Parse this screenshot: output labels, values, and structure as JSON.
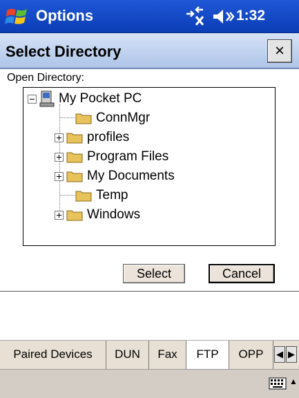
{
  "topbar": {
    "title": "Options",
    "time": "1:32"
  },
  "dialog": {
    "title": "Select Directory",
    "close_label": "×",
    "open_label": "Open Directory:",
    "tree": {
      "root": "My Pocket PC",
      "items": [
        {
          "label": "ConnMgr",
          "expandable": false
        },
        {
          "label": "profiles",
          "expandable": true
        },
        {
          "label": "Program Files",
          "expandable": true
        },
        {
          "label": "My Documents",
          "expandable": true
        },
        {
          "label": "Temp",
          "expandable": false
        },
        {
          "label": "Windows",
          "expandable": true
        }
      ]
    },
    "select_label": "Select",
    "cancel_label": "Cancel"
  },
  "tabs": [
    {
      "label": "Paired Devices",
      "active": false
    },
    {
      "label": "DUN",
      "active": false
    },
    {
      "label": "Fax",
      "active": false
    },
    {
      "label": "FTP",
      "active": true
    },
    {
      "label": "OPP",
      "active": false
    }
  ],
  "tab_scroll": {
    "left": "◀",
    "right": "▶"
  },
  "menubar": {
    "sip_arrow": "▲"
  },
  "icons": {
    "start": "windows-flag-icon",
    "connectivity": "connectivity-icon",
    "volume": "speaker-icon",
    "keyboard": "keyboard-icon"
  },
  "colors": {
    "titlebar": "#0b3db6",
    "dialog_header": "#aec4e8",
    "folder": "#e8c25a",
    "button_face": "#ece4da"
  }
}
